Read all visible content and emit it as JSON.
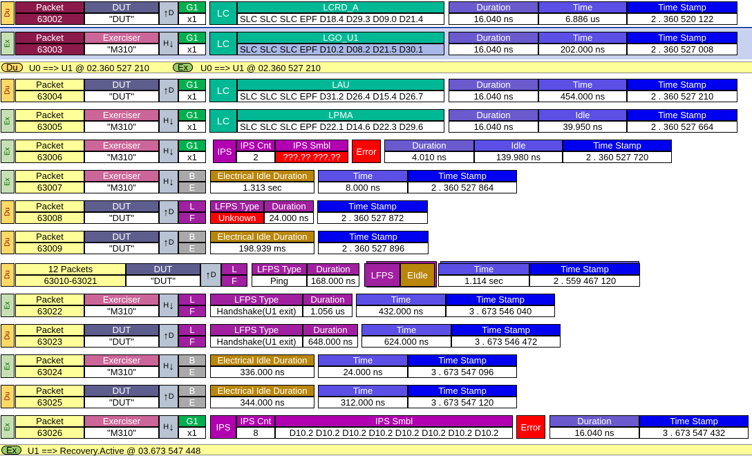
{
  "labels": {
    "packet": "Packet",
    "exerciser": "Exerciser",
    "dut": "DUT",
    "g1": "G1",
    "x1": "x1",
    "lc": "LC",
    "duration": "Duration",
    "time": "Time",
    "idle": "Idle",
    "timestamp": "Time Stamp",
    "ips": "IPS",
    "ips_cnt": "IPS Cnt",
    "ips_smbl": "IPS Smbl",
    "error": "Error",
    "b": "B",
    "e": "E",
    "l": "L",
    "f": "F",
    "eidle_duration": "Electrical Idle Duration",
    "lfps_type": "LFPS Type",
    "lfps": "LFPS",
    "eidle": "EIdle",
    "du_tag": "Du",
    "ex_tag": "Ex",
    "d_dir": "D",
    "h_dir": "H",
    "up_arrow": "↑",
    "down_arrow": "↓"
  },
  "rows": [
    {
      "tag": "Du",
      "num": "63002",
      "dev": "\"DUT\"",
      "lc_name": "LCRD_A",
      "lc_sym": "SLC SLC SLC EPF D18.4 D29.3 D09.0 D21.4",
      "duration": "16.040 ns",
      "t_label": "Time",
      "t_value": "6.886 us",
      "ts": "2 . 360 520 122"
    },
    {
      "tag": "Ex",
      "num": "63003",
      "dev": "\"M310\"",
      "lc_name": "LGO_U1",
      "lc_sym": "SLC SLC SLC EPF D10.2 D08.2 D21.5 D30.1",
      "duration": "16.040 ns",
      "t_label": "Time",
      "t_value": "202.000 ns",
      "ts": "2 . 360 527 008"
    },
    {
      "tag": "Du",
      "num": "63004",
      "dev": "\"DUT\"",
      "lc_name": "LAU",
      "lc_sym": "SLC SLC SLC EPF D31.2 D26.4 D15.4 D26.7",
      "duration": "16.040 ns",
      "t_label": "Time",
      "t_value": "454.000 ns",
      "ts": "2 . 360 527 210"
    },
    {
      "tag": "Ex",
      "num": "63005",
      "dev": "\"M310\"",
      "lc_name": "LPMA",
      "lc_sym": "SLC SLC SLC EPF D22.1 D14.6 D22.3 D29.6",
      "duration": "16.040 ns",
      "t_label": "Idle",
      "t_value": "39.950 ns",
      "ts": "2 . 360 527 664"
    },
    {
      "tag": "Ex",
      "num": "63006",
      "dev": "\"M310\"",
      "ips_cnt": "2",
      "ips_smbl": "???.?? ???.??",
      "duration": "4.010 ns",
      "t_label": "Idle",
      "t_value": "139.980 ns",
      "ts": "2 . 360 527 720"
    },
    {
      "tag": "Ex",
      "num": "63007",
      "dev": "\"M310\"",
      "eidle": "1.313 sec",
      "t_value": "8.000 ns",
      "ts": "2 . 360 527 864"
    },
    {
      "tag": "Du",
      "num": "63008",
      "dev": "\"DUT\"",
      "lfps_type": "Unknown",
      "duration": "24.000 ns",
      "ts": "2 . 360 527 872"
    },
    {
      "tag": "Du",
      "num": "63009",
      "dev": "\"DUT\"",
      "eidle": "198.939 ms",
      "ts": "2 . 360 527 896"
    },
    {
      "tag": "Du",
      "count": "12 Packets",
      "num": "63010-63021",
      "dev": "\"DUT\"",
      "lfps_type": "Ping",
      "duration": "168.000 ns",
      "t_value": "1.114 sec",
      "ts": "2 . 559 467 120"
    },
    {
      "tag": "Ex",
      "num": "63022",
      "dev": "\"M310\"",
      "lfps_type": "Handshake(U1 exit)",
      "duration": "1.056 us",
      "t_value": "432.000 ns",
      "ts": "3 . 673 546 040"
    },
    {
      "tag": "Du",
      "num": "63023",
      "dev": "\"DUT\"",
      "lfps_type": "Handshake(U1 exit)",
      "duration": "648.000 ns",
      "t_value": "624.000 ns",
      "ts": "3 . 673 546 472"
    },
    {
      "tag": "Ex",
      "num": "63024",
      "dev": "\"M310\"",
      "eidle": "336.000 ns",
      "t_value": "24.000 ns",
      "ts": "3 . 673 547 096"
    },
    {
      "tag": "Du",
      "num": "63025",
      "dev": "\"DUT\"",
      "eidle": "344.000 ns",
      "t_value": "312.000 ns",
      "ts": "3 . 673 547 120"
    },
    {
      "tag": "Ex",
      "num": "63026",
      "dev": "\"M310\"",
      "ips_cnt": "8",
      "ips_smbl": "D10.2 D10.2 D10.2 D10.2 D10.2 D10.2 D10.2 D10.2",
      "duration": "16.040 ns",
      "ts": "3 . 673 547 432"
    }
  ],
  "transitions": {
    "first_du": "U0 ==> U1 @ 02.360 527 210",
    "first_ex": "U0 ==> U1 @ 02.360 527 210",
    "last_ex": "U1 ==> Recovery.Active @ 03.673 547 448"
  },
  "colors": {
    "dut_header": "#5e5e8e",
    "exerciser_header": "#cc6699",
    "timestamp": "#0000f0",
    "error": "#ff0000",
    "separator": "#ffff99"
  }
}
